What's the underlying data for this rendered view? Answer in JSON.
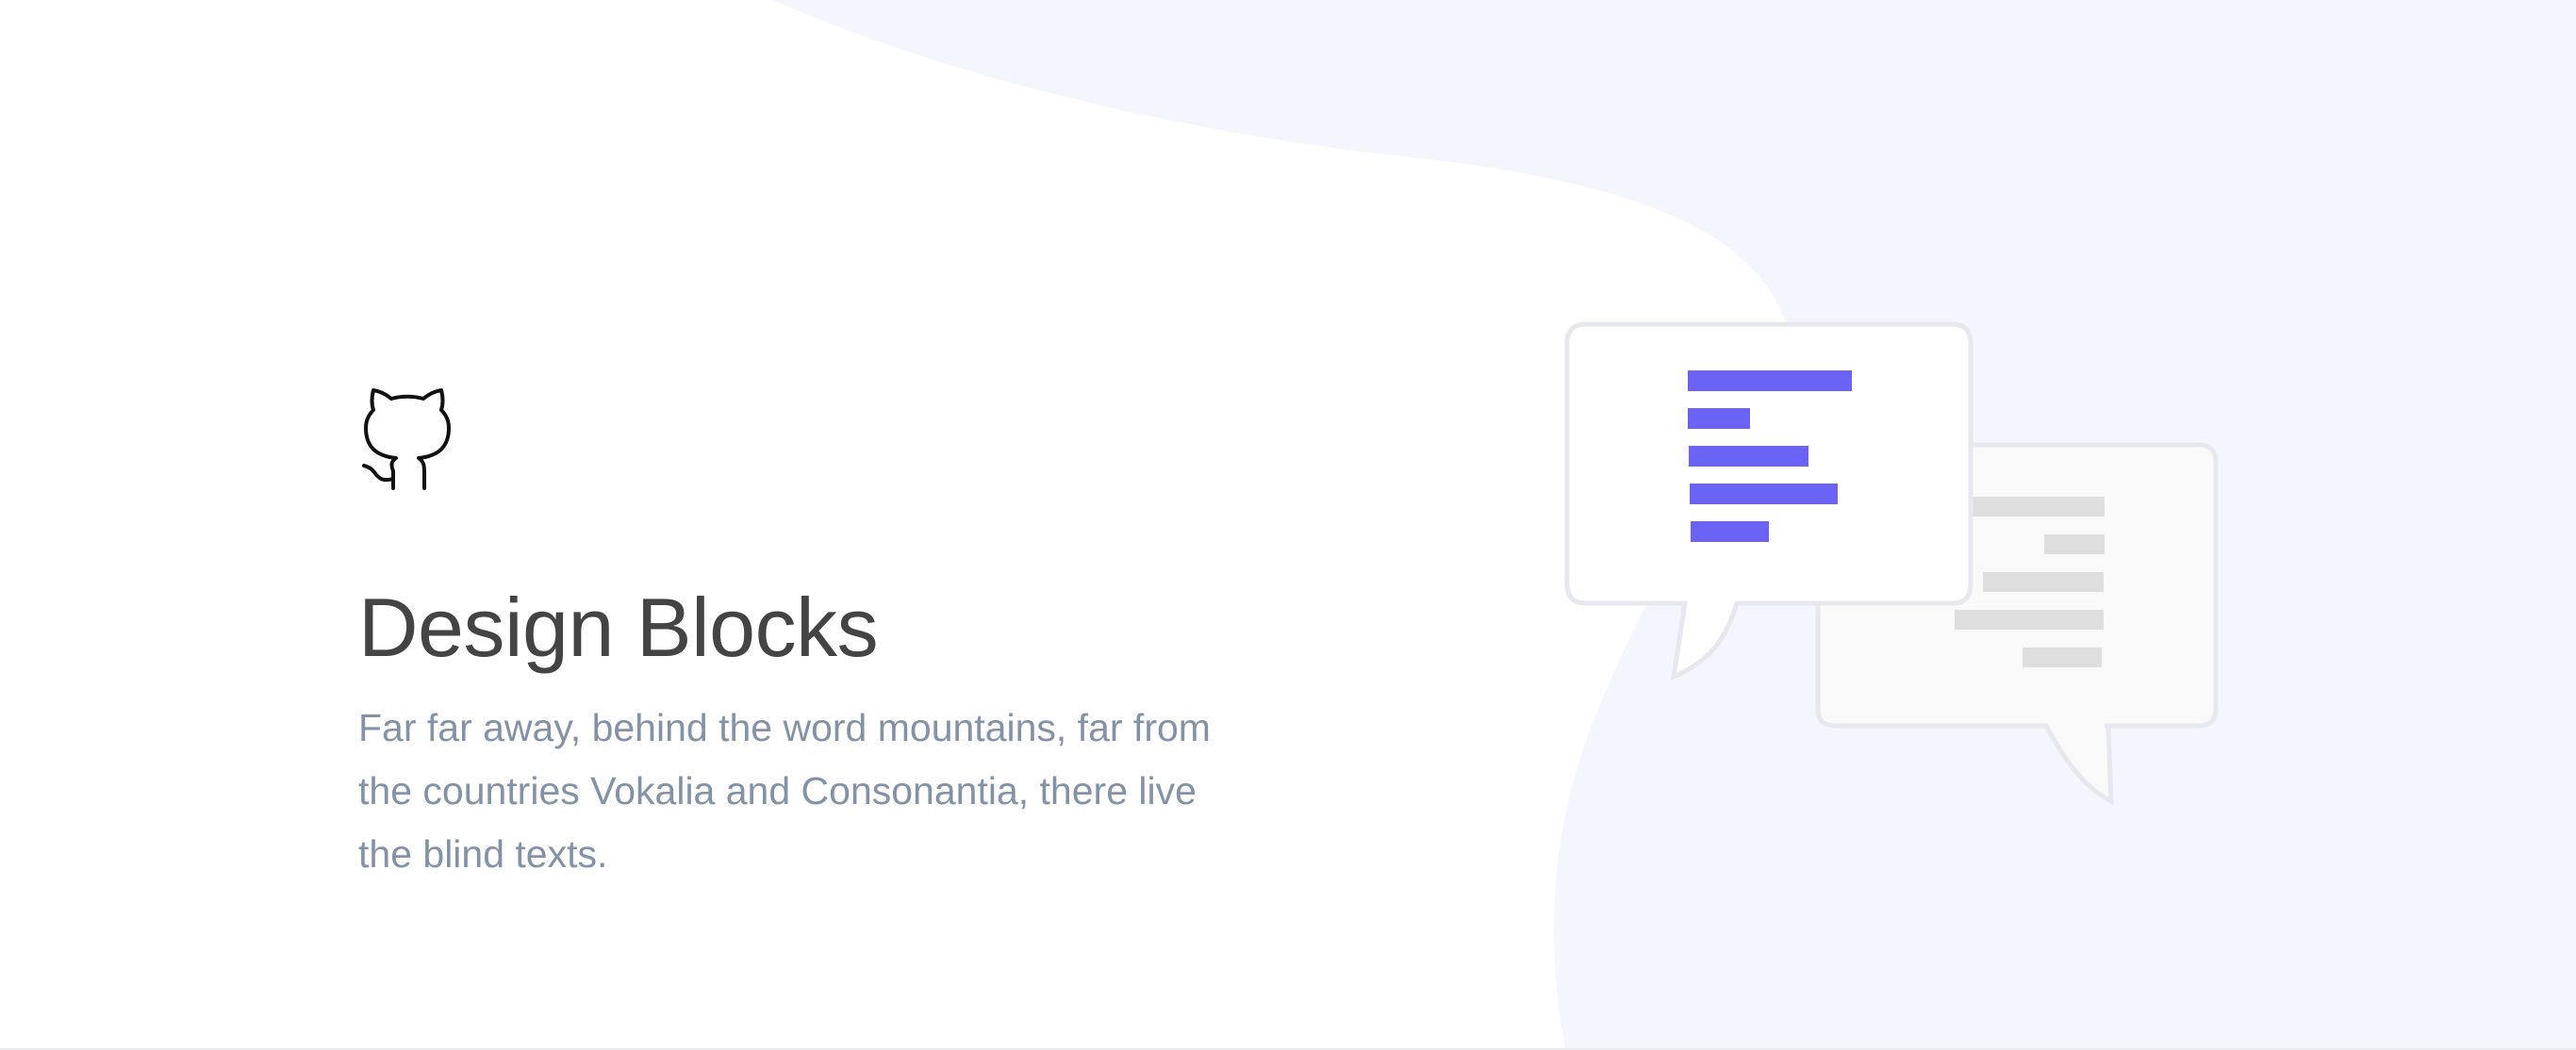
{
  "hero": {
    "title": "Design Blocks",
    "subtitle": "Far far away, behind the word mountains, far from the countries Vokalia and Consonantia, there live the blind texts."
  },
  "icons": {
    "brand": "github-octocat-icon",
    "front_bubble": "chat-bubble-icon",
    "back_bubble": "chat-bubble-icon"
  },
  "colors": {
    "page_background": "#ffffff",
    "blob_background": "#f3f6fd",
    "title": "#444444",
    "subtitle": "#8492a6",
    "accent": "#6a63f6",
    "placeholder_lines": "#dedede",
    "bubble_border": "#e6e8ee",
    "back_bubble_fill": "#f9f9f9",
    "divider": "#e9ecef"
  }
}
